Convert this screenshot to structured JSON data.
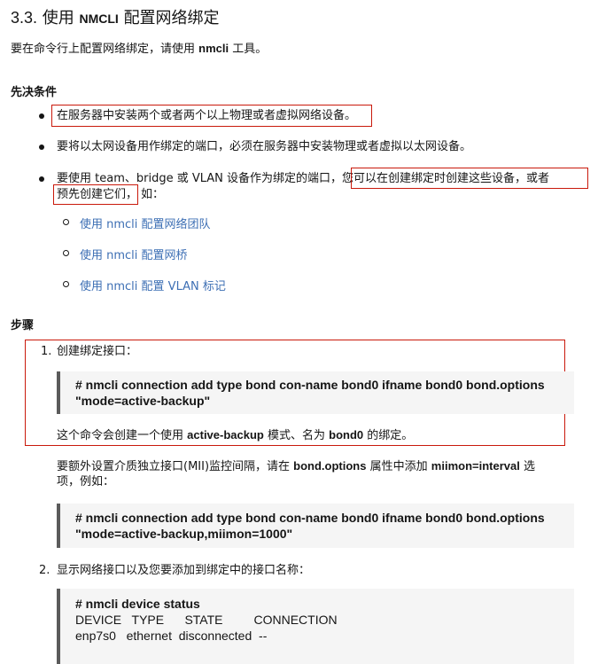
{
  "heading": {
    "number": "3.3.",
    "prefix": "使用",
    "code": "NMCLI",
    "suffix": "配置网络绑定"
  },
  "intro": {
    "pre": "要在命令行上配置网络绑定，请使用",
    "cmd": "nmcli",
    "post": "工具。"
  },
  "prereq": {
    "title": "先决条件",
    "items": [
      "在服务器中安装两个或者两个以上物理或者虚拟网络设备。",
      "要将以太网设备用作绑定的端口，必须在服务器中安装物理或者虚拟以太网设备。"
    ],
    "item3": {
      "part1": "要使用 team、bridge 或 VLAN 设备作为绑定的端口，",
      "part2": "您可以在创建绑定时创建这些设备，或者",
      "part3": "预先创建它们，",
      "part4": "如：",
      "links": [
        "使用 nmcli 配置网络团队",
        "使用 nmcli 配置网桥",
        "使用 nmcli 配置 VLAN 标记"
      ]
    }
  },
  "steps": {
    "title": "步骤",
    "step1": {
      "num": "1.",
      "label": "创建绑定接口：",
      "code_l1": "# nmcli connection add type bond con-name bond0 ifname bond0 bond.options",
      "code_l2": "\"mode=active-backup\"",
      "desc_pre": "这个命令会创建一个使用",
      "desc_b1": "active-backup",
      "desc_mid": "模式、名为",
      "desc_b2": "bond0",
      "desc_post": "的绑定。",
      "mii_pre": "要额外设置介质独立接口(MII)监控间隔，请在",
      "mii_b1": "bond.options",
      "mii_mid": "属性中添加",
      "mii_b2": "miimon=interval",
      "mii_post": "选",
      "mii_line2": "项，例如：",
      "code2_l1": "# nmcli connection add type bond con-name bond0 ifname bond0 bond.options",
      "code2_l2": "\"mode=active-backup,miimon=1000\""
    },
    "step2": {
      "num": "2.",
      "label": "显示网络接口以及您要添加到绑定中的接口名称：",
      "code_l1": "# nmcli device status",
      "code_l2": "DEVICE   TYPE      STATE         CONNECTION",
      "code_l3": "enp7s0   ethernet  disconnected  --"
    }
  },
  "colors": {
    "highlight": "#c9190b",
    "link": "#3d6fb4",
    "code_bg": "#f5f5f5"
  }
}
